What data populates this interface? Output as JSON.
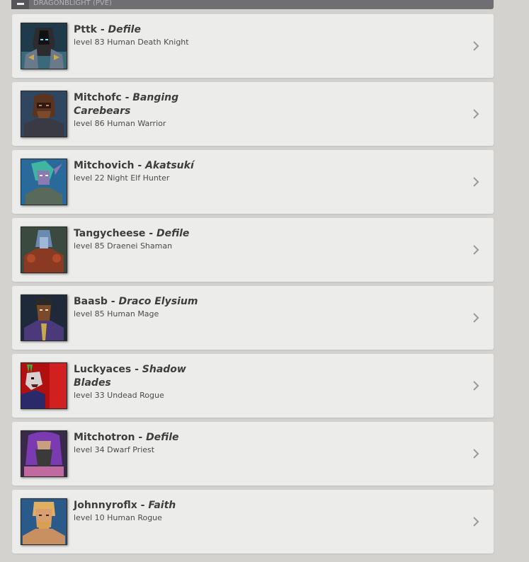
{
  "realm": {
    "name": "Dragonblight (PVE)"
  },
  "characters": [
    {
      "name": "Pttk",
      "separator": " - ",
      "guild": "Defile",
      "details": "level 83 Human Death Knight",
      "portrait": "death-knight-portrait"
    },
    {
      "name": "Mitchofc",
      "separator": " - ",
      "guild": "Banging Carebears",
      "details": "level 86 Human Warrior",
      "portrait": "warrior-portrait"
    },
    {
      "name": "Mitchovich",
      "separator": " - ",
      "guild": "Akatsukí",
      "details": "level 22 Night Elf Hunter",
      "portrait": "hunter-portrait"
    },
    {
      "name": "Tangycheese",
      "separator": " - ",
      "guild": "Defile",
      "details": "level 85 Draenei Shaman",
      "portrait": "shaman-portrait"
    },
    {
      "name": "Baasb",
      "separator": " - ",
      "guild": "Draco Elysium",
      "details": "level 85 Human Mage",
      "portrait": "mage-portrait"
    },
    {
      "name": "Luckyaces",
      "separator": " - ",
      "guild": "Shadow Blades",
      "details": "level 33 Undead Rogue",
      "portrait": "undead-rogue-portrait"
    },
    {
      "name": "Mitchotron",
      "separator": " - ",
      "guild": "Defile",
      "details": "level 34 Dwarf Priest",
      "portrait": "priest-portrait"
    },
    {
      "name": "Johnnyroflx",
      "separator": " - ",
      "guild": "Faith",
      "details": "level 10 Human Rogue",
      "portrait": "human-rogue-portrait"
    }
  ],
  "icons": {
    "collapse": "minus-icon",
    "open": "chevron-right-icon"
  },
  "colors": {
    "card": "#ececea",
    "background": "#d3d2ce",
    "header": "#6f6f73"
  }
}
